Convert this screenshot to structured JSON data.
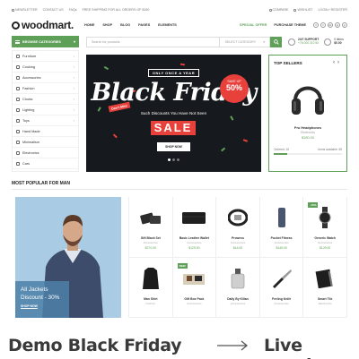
{
  "topbar": {
    "left": [
      "NEWSLETTER",
      "CONTACT US",
      "FAQs",
      "FREE SHIPPING FOR ALL ORDERS OF $150"
    ],
    "right": [
      "COMPARE",
      "WISHLIST",
      "LOGIN / REGISTER"
    ]
  },
  "header": {
    "logo": "woodmart.",
    "nav": [
      "HOME",
      "SHOP",
      "BLOG",
      "PAGES",
      "ELEMENTS"
    ],
    "special_offer": "SPECIAL OFFER",
    "purchase_theme": "PURCHASE THEME",
    "socials": [
      "f",
      "t",
      "in",
      "p",
      "y"
    ]
  },
  "searchrow": {
    "categories_label": "BROWSE CATEGORIES",
    "search_placeholder": "Search for products",
    "select_label": "SELECT CATEGORY",
    "support_title": "24/7 SUPPORT",
    "support_phone": "+76 000 210 54",
    "cart_count": "0 items",
    "cart_total": "$0.00"
  },
  "categories": [
    "Furniture",
    "Cooking",
    "Accessories",
    "Fashion",
    "Clocks",
    "Lighting",
    "Toys",
    "Hand Made",
    "Minimalism",
    "Electronics",
    "Cars"
  ],
  "banner": {
    "pre": "ONLY ONCE A YEAR",
    "title": "Black Friday",
    "tag": "Don't Miss",
    "subtitle": "Such Discounts You Have Not Seen",
    "sale": "SALE",
    "button": "SHOP NOW",
    "off_pre": "SAVE UP",
    "off_value": "50%"
  },
  "top_sellers": {
    "title": "TOP SELLERS",
    "product_name": "Pro Headphones",
    "product_category": "Electronics",
    "price": "$150.00",
    "ordered": "Ordered: 16",
    "available": "Items available: 65",
    "progress": 0.2
  },
  "section": {
    "title": "MOST POPULAR FOR MAN"
  },
  "promo": {
    "line1": "All Jackets",
    "line2": "Discount - 30%",
    "button": "SHOP NOW"
  },
  "products": [
    {
      "name": "Gift Black Set",
      "category": "Accessories",
      "price": "$270.00",
      "badge": "",
      "icon": "wallet-set-icon"
    },
    {
      "name": "Basic Leather Wallet",
      "category": "Accessories",
      "price": "$129.00",
      "badge": "",
      "icon": "wallet-icon"
    },
    {
      "name": "Prowess",
      "category": "Accessories",
      "price": "$44.00",
      "badge": "",
      "icon": "belt-icon"
    },
    {
      "name": "Pocket Fitness",
      "category": "Accessories",
      "price": "$145.00",
      "badge": "",
      "icon": "power-bank-icon"
    },
    {
      "name": "Generic Watch",
      "category": "Accessories",
      "price": "$129.00",
      "badge": "-15%",
      "icon": "watch-icon"
    },
    {
      "name": "Man Shirt",
      "category": "Fashion",
      "price": "",
      "badge": "",
      "icon": "shirt-icon"
    },
    {
      "name": "Gift Box Pack",
      "category": "Accessories",
      "price": "",
      "badge": "NEW",
      "icon": "gift-box-icon"
    },
    {
      "name": "Daily By Kilian",
      "category": "Accessories",
      "price": "",
      "badge": "",
      "icon": "perfume-icon"
    },
    {
      "name": "Feeling Knife",
      "category": "Accessories",
      "price": "",
      "badge": "",
      "icon": "knife-icon"
    },
    {
      "name": "Smart Tile",
      "category": "Electronics",
      "price": "",
      "badge": "",
      "icon": "notebook-icon"
    }
  ],
  "footer": {
    "caption": "Demo Black Friday",
    "preview": "Live preview"
  },
  "colors": {
    "accent": "#5fa058",
    "sale_red": "#e8413b",
    "banner_bg": "#16191d"
  }
}
